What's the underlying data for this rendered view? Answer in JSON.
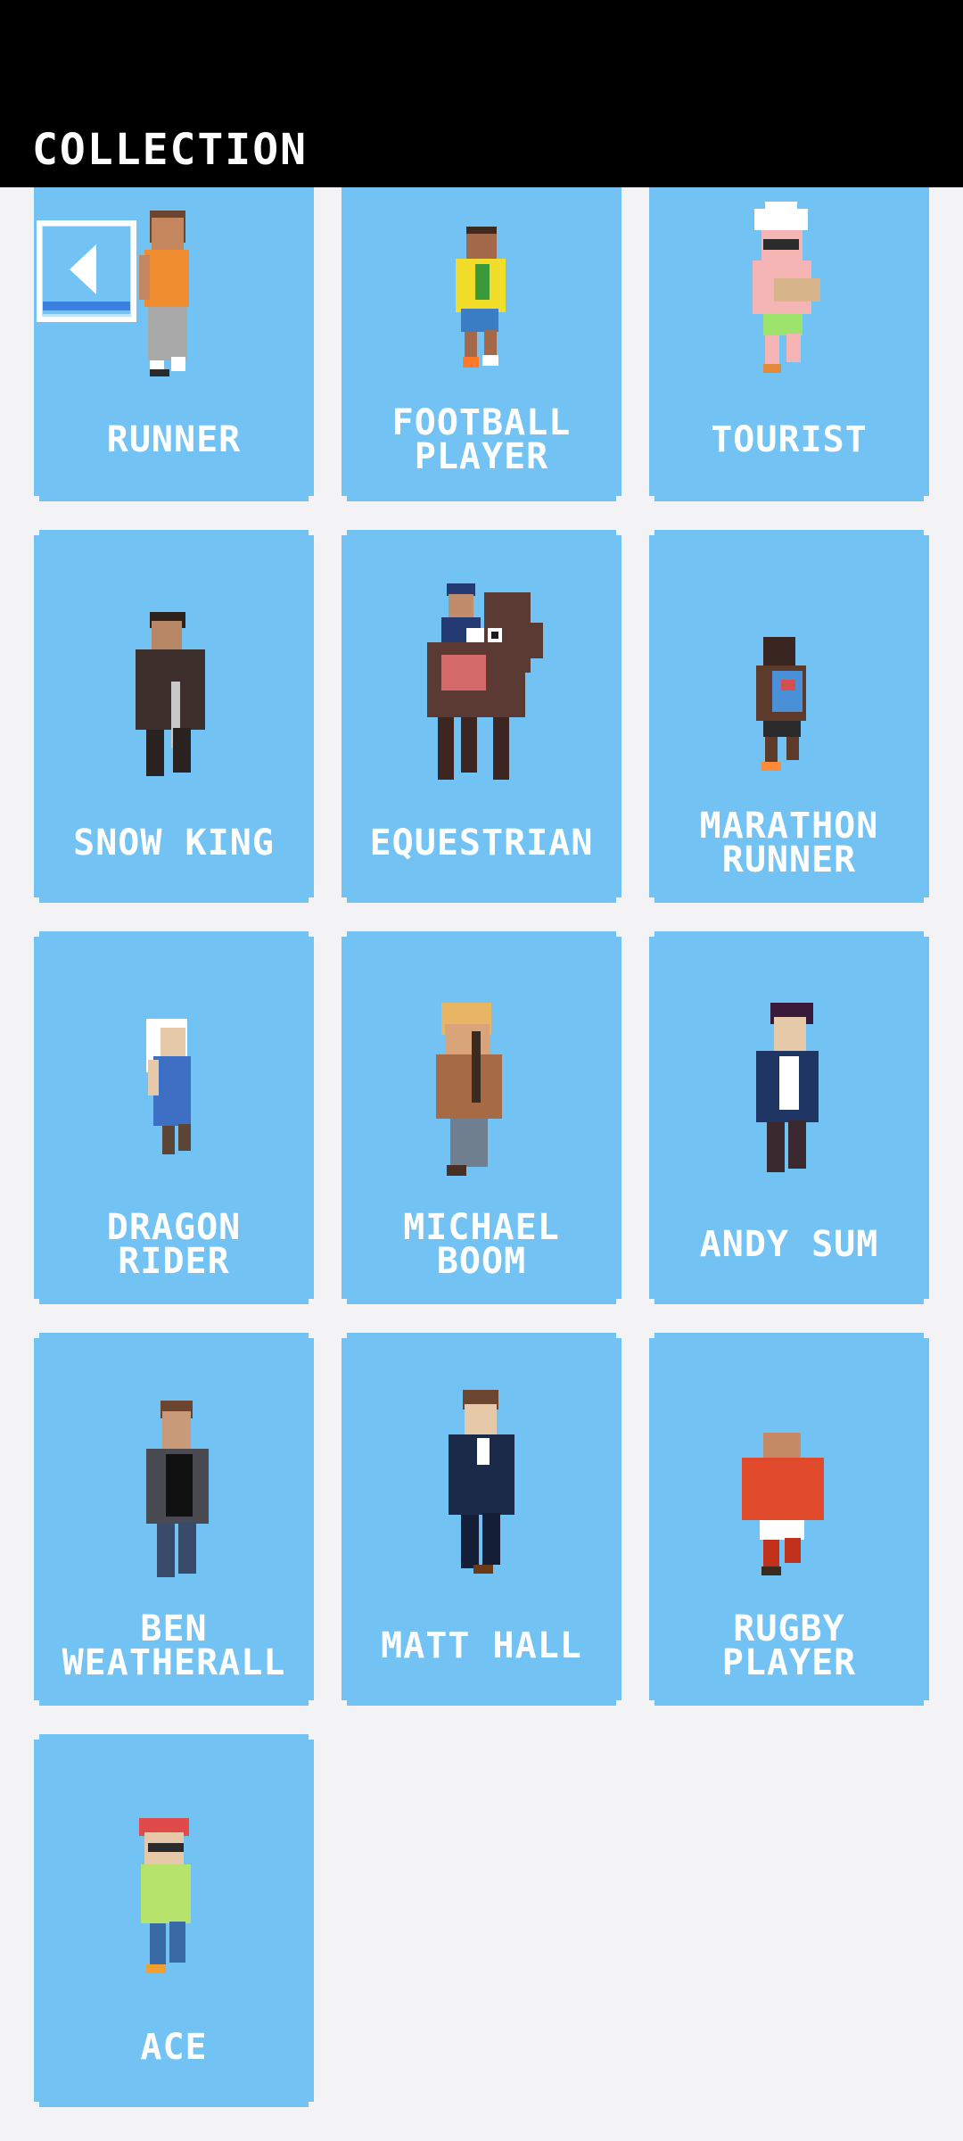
{
  "header": {
    "title": "COLLECTION"
  },
  "back_button": {
    "icon": "back-arrow-icon"
  },
  "cards": [
    {
      "label": "RUNNER"
    },
    {
      "label": "FOOTBALL\nPLAYER"
    },
    {
      "label": "TOURIST"
    },
    {
      "label": "SNOW KING"
    },
    {
      "label": "EQUESTRIAN"
    },
    {
      "label": "MARATHON\nRUNNER"
    },
    {
      "label": "DRAGON\nRIDER"
    },
    {
      "label": "MICHAEL\nBOOM"
    },
    {
      "label": "ANDY SUM"
    },
    {
      "label": "BEN\nWEATHERALL"
    },
    {
      "label": "MATT HALL"
    },
    {
      "label": "RUGBY\nPLAYER"
    },
    {
      "label": "ACE"
    }
  ],
  "colors": {
    "header_bg": "#000000",
    "card_bg": "#72c3f4",
    "page_bg": "#f3f3f5",
    "text": "#ffffff"
  }
}
